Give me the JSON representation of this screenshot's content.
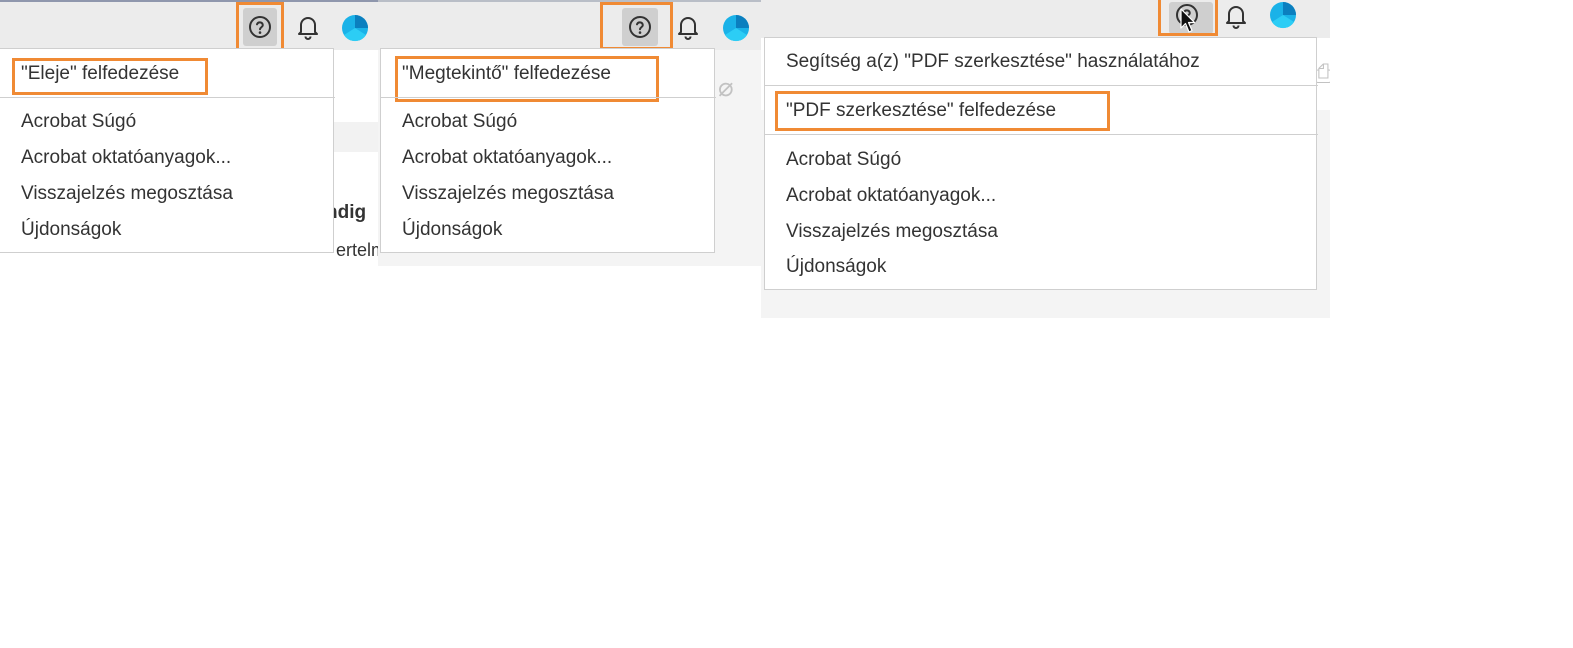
{
  "panel1": {
    "highlight_item": "\"Eleje\" felfedezése",
    "items": [
      "Acrobat Súgó",
      "Acrobat oktatóanyagok...",
      "Visszajelzés megosztása",
      "Újdonságok"
    ],
    "bg_text_1": "ndig",
    "bg_text_2": "ertelm"
  },
  "panel2": {
    "highlight_item": "\"Megtekintő\" felfedezése",
    "items": [
      "Acrobat Súgó",
      "Acrobat oktatóanyagok...",
      "Visszajelzés megosztása",
      "Újdonságok"
    ]
  },
  "panel3": {
    "header_item": "Segítség a(z) \"PDF szerkesztése\" használatához",
    "highlight_item": "\"PDF szerkesztése\" felfedezése",
    "items": [
      "Acrobat Súgó",
      "Acrobat oktatóanyagok...",
      "Visszajelzés megosztása",
      "Újdonságok"
    ]
  },
  "icons": {
    "help": "help-question-icon",
    "bell": "notification-bell-icon",
    "avatar": "user-avatar-icon",
    "cursor": "mouse-cursor-icon"
  },
  "colors": {
    "highlight": "#f08a34",
    "avatar": "#1ab2e8",
    "topbar": "#ececec"
  }
}
